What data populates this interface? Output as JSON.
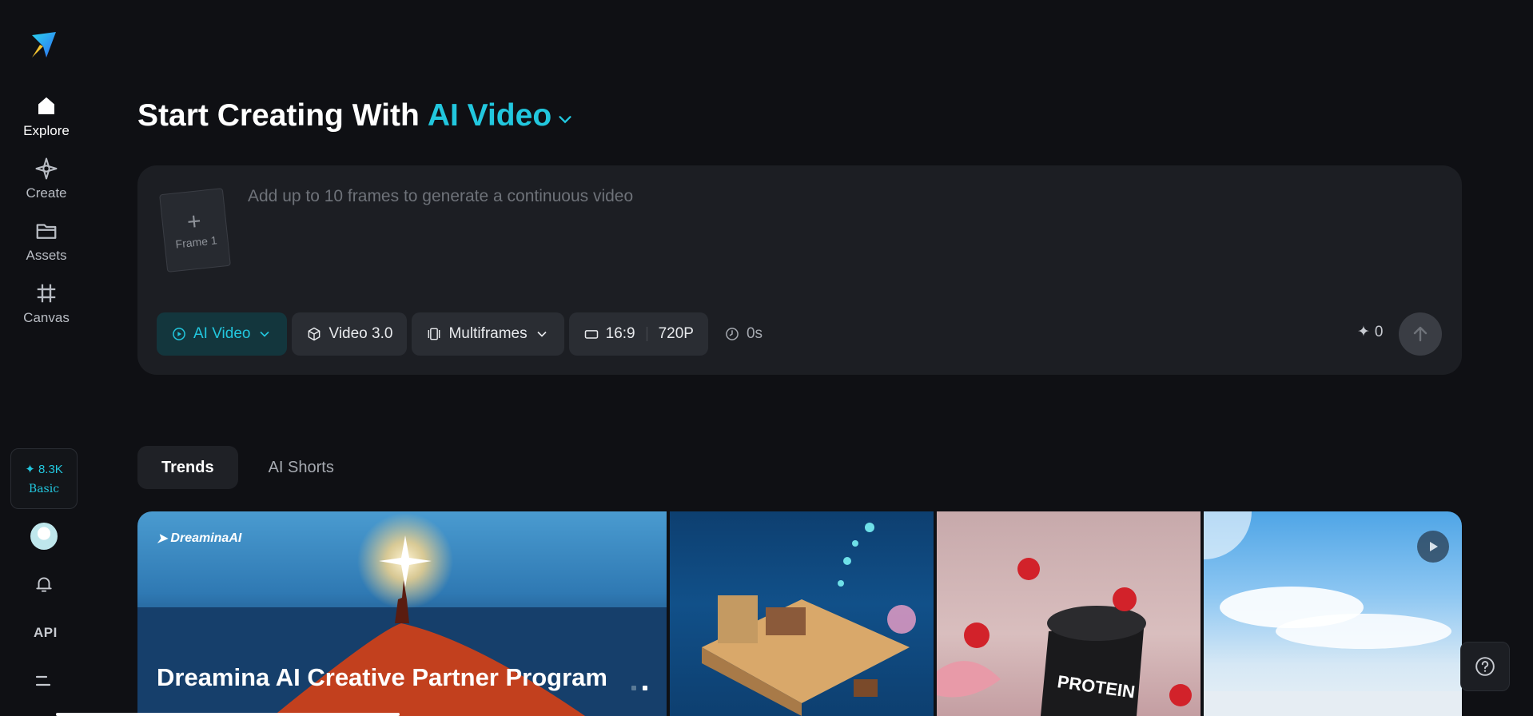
{
  "sidebar": {
    "items": [
      {
        "label": "Explore",
        "icon": "home-icon"
      },
      {
        "label": "Create",
        "icon": "sparkle-icon"
      },
      {
        "label": "Assets",
        "icon": "folder-icon"
      },
      {
        "label": "Canvas",
        "icon": "frame-grid-icon"
      }
    ],
    "credits": {
      "value": "✦ 8.3K",
      "tier": "Basic"
    },
    "api_label": "API"
  },
  "header": {
    "prefix": "Start Creating With",
    "mode": "AI Video"
  },
  "composer": {
    "frame_label": "Frame 1",
    "prompt_placeholder": "Add up to 10 frames to generate a continuous video",
    "toolbar": {
      "mode": "AI Video",
      "model": "Video 3.0",
      "frames_mode": "Multiframes",
      "ratio": "16:9",
      "resolution": "720P",
      "duration": "0s"
    },
    "cost": "0"
  },
  "tabs": [
    {
      "label": "Trends",
      "active": true
    },
    {
      "label": "AI Shorts",
      "active": false
    }
  ],
  "gallery": {
    "banner_brand": "DreaminaAI",
    "banner_title": "Dreamina AI Creative Partner Program",
    "carousel_pages": 2,
    "carousel_active": 2
  },
  "colors": {
    "accent": "#22c7de",
    "background": "#0f1014",
    "panel": "#1c1e23"
  }
}
